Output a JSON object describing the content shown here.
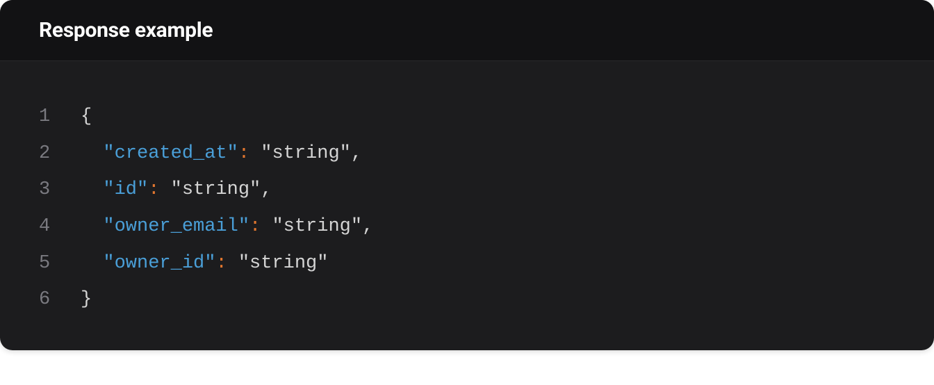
{
  "panel": {
    "title": "Response example"
  },
  "code": {
    "lines": [
      {
        "num": "1",
        "indent": "",
        "tokens": [
          {
            "t": "brace",
            "v": "{"
          }
        ]
      },
      {
        "num": "2",
        "indent": "  ",
        "tokens": [
          {
            "t": "key",
            "v": "\"created_at\""
          },
          {
            "t": "colon",
            "v": ":"
          },
          {
            "t": "plain",
            "v": " "
          },
          {
            "t": "string",
            "v": "\"string\""
          },
          {
            "t": "comma",
            "v": ","
          }
        ]
      },
      {
        "num": "3",
        "indent": "  ",
        "tokens": [
          {
            "t": "key",
            "v": "\"id\""
          },
          {
            "t": "colon",
            "v": ":"
          },
          {
            "t": "plain",
            "v": " "
          },
          {
            "t": "string",
            "v": "\"string\""
          },
          {
            "t": "comma",
            "v": ","
          }
        ]
      },
      {
        "num": "4",
        "indent": "  ",
        "tokens": [
          {
            "t": "key",
            "v": "\"owner_email\""
          },
          {
            "t": "colon",
            "v": ":"
          },
          {
            "t": "plain",
            "v": " "
          },
          {
            "t": "string",
            "v": "\"string\""
          },
          {
            "t": "comma",
            "v": ","
          }
        ]
      },
      {
        "num": "5",
        "indent": "  ",
        "tokens": [
          {
            "t": "key",
            "v": "\"owner_id\""
          },
          {
            "t": "colon",
            "v": ":"
          },
          {
            "t": "plain",
            "v": " "
          },
          {
            "t": "string",
            "v": "\"string\""
          }
        ]
      },
      {
        "num": "6",
        "indent": "",
        "tokens": [
          {
            "t": "brace",
            "v": "}"
          }
        ]
      }
    ]
  }
}
